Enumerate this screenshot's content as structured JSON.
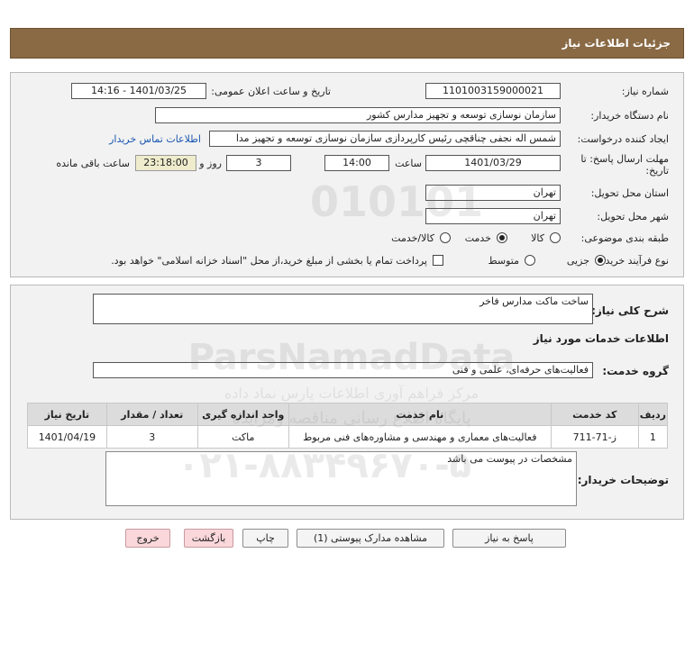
{
  "header": {
    "title": "جزئیات اطلاعات نیاز"
  },
  "form": {
    "need_number_label": "شماره نیاز:",
    "need_number": "1101003159000021",
    "announce_label": "تاریخ و ساعت اعلان عمومی:",
    "announce_value": "1401/03/25 - 14:16",
    "buyer_org_label": "نام دستگاه خریدار:",
    "buyer_org": "سازمان نوسازی  توسعه و تجهیز مدارس کشور",
    "creator_label": "ایجاد کننده درخواست:",
    "creator": "شمس اله نجفی چناقچی رئیس کارپردازی سازمان نوسازی  توسعه و تجهیز مدا",
    "contact_link": "اطلاعات تماس خریدار",
    "deadline_label": "مهلت ارسال پاسخ: تا تاریخ:",
    "deadline_date": "1401/03/29",
    "time_label": "ساعت",
    "deadline_time": "14:00",
    "days_value": "3",
    "days_label": "روز و",
    "remaining_time": "23:18:00",
    "remaining_label": "ساعت باقی مانده",
    "province_label": "استان محل تحویل:",
    "province": "تهران",
    "city_label": "شهر محل تحویل:",
    "city": "تهران",
    "category_label": "طبقه بندی موضوعی:",
    "category_options": [
      "کالا",
      "خدمت",
      "کالا/خدمت"
    ],
    "category_selected": "خدمت",
    "process_label": "نوع فرآیند خرید :",
    "process_options": [
      "جزیی",
      "متوسط"
    ],
    "process_selected": "جزیی",
    "payment_note": "پرداخت تمام یا بخشی از مبلغ خرید،از محل \"اسناد خزانه اسلامی\" خواهد بود."
  },
  "details": {
    "summary_label": "شرح کلی نیاز:",
    "summary": "ساخت ماکت مدارس فاخر",
    "services_title": "اطلاعات خدمات مورد نیاز",
    "service_group_label": "گروه خدمت:",
    "service_group": "فعالیت‌های حرفه‌ای، علمی و فنی",
    "table": {
      "headers": [
        "ردیف",
        "کد خدمت",
        "نام خدمت",
        "واحد اندازه گیری",
        "تعداد / مقدار",
        "تاریخ نیاز"
      ],
      "rows": [
        [
          "1",
          "ز-71-711",
          "فعالیت‌های معماری و مهندسی و مشاوره‌های فنی مربوط",
          "ماکت",
          "3",
          "1401/04/19"
        ]
      ]
    },
    "buyer_notes_label": "توضیحات خریدار:",
    "buyer_notes": "مشخصات در پیوست می باشد"
  },
  "buttons": {
    "reply": "پاسخ به نیاز",
    "attachments": "مشاهده مدارک پیوستی (1)",
    "print": "چاپ",
    "back": "بازگشت",
    "exit": "خروج"
  },
  "watermark": {
    "digits": "010101",
    "brand": "ParsNamadData",
    "tagline1": "مرکز فراهم آوری اطلاعات پارس نماد داده",
    "tagline2": "پایگاه اطلاع رسانی مناقصه ومزایده",
    "phone": "۰۲۱-۸۸۳۴۹۶۷۰-۵"
  },
  "colors": {
    "header": "#8a6a45",
    "panel": "#f2f2f2",
    "link": "#1a56b0",
    "remaining_bg": "#eeeccc"
  }
}
